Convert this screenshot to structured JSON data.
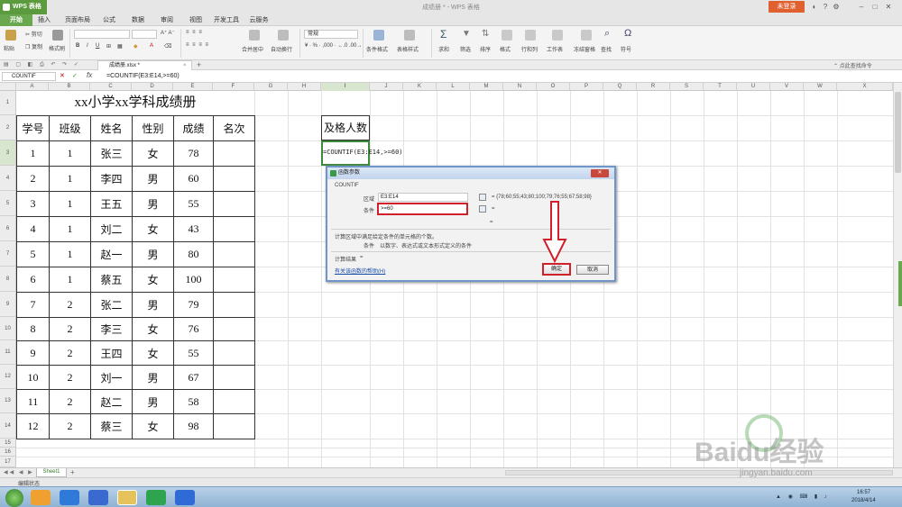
{
  "window": {
    "app_label": "WPS 表格",
    "title": "成绩册 * - WPS 表格",
    "login_label": "未登录"
  },
  "menu": [
    "开始",
    "插入",
    "页面布局",
    "公式",
    "数据",
    "审阅",
    "视图",
    "开发工具",
    "云服务"
  ],
  "ribbon": {
    "paste": "粘贴",
    "cut": "剪切",
    "copy": "复制",
    "format_painter": "格式刷",
    "merge_center": "合并居中",
    "wrap_text": "自动换行",
    "number_format": "常规",
    "conditional_format": "条件格式",
    "table_style": "表格样式",
    "sum": "求和",
    "filter": "筛选",
    "sort": "排序",
    "format": "格式",
    "rows_cols": "行和列",
    "worksheet": "工作表",
    "freeze": "冻结窗格",
    "find": "查找",
    "symbol": "符号"
  },
  "doc_tab": "成绩册.xlsx *",
  "collapse_label": "点此查找命令",
  "formula_bar": {
    "name_box": "COUNTIF",
    "formula": "=COUNTIF(E3:E14,>=60)"
  },
  "columns": [
    "A",
    "B",
    "C",
    "D",
    "E",
    "F",
    "G",
    "H",
    "I",
    "J",
    "K",
    "L",
    "M",
    "N",
    "O",
    "P",
    "Q",
    "R",
    "S",
    "T",
    "U",
    "V",
    "W",
    "X"
  ],
  "row_numbers": [
    "1",
    "2",
    "3",
    "4",
    "5",
    "6",
    "7",
    "8",
    "9",
    "10",
    "11",
    "12",
    "13",
    "14",
    "15",
    "16",
    "17"
  ],
  "sheet": {
    "title": "xx小学xx学科成绩册",
    "headers": [
      "学号",
      "班级",
      "姓名",
      "性别",
      "成绩",
      "名次"
    ],
    "rows": [
      [
        "1",
        "1",
        "张三",
        "女",
        "78",
        ""
      ],
      [
        "2",
        "1",
        "李四",
        "男",
        "60",
        ""
      ],
      [
        "3",
        "1",
        "王五",
        "男",
        "55",
        ""
      ],
      [
        "4",
        "1",
        "刘二",
        "女",
        "43",
        ""
      ],
      [
        "5",
        "1",
        "赵一",
        "男",
        "80",
        ""
      ],
      [
        "6",
        "1",
        "蔡五",
        "女",
        "100",
        ""
      ],
      [
        "7",
        "2",
        "张二",
        "男",
        "79",
        ""
      ],
      [
        "8",
        "2",
        "李三",
        "女",
        "76",
        ""
      ],
      [
        "9",
        "2",
        "王四",
        "女",
        "55",
        ""
      ],
      [
        "10",
        "2",
        "刘一",
        "男",
        "67",
        ""
      ],
      [
        "11",
        "2",
        "赵二",
        "男",
        "58",
        ""
      ],
      [
        "12",
        "2",
        "蔡三",
        "女",
        "98",
        ""
      ]
    ],
    "pass_label": "及格人数",
    "editing_formula": "=COUNTIF(E3:E14,>=60)"
  },
  "dialog": {
    "title": "函数参数",
    "func": "COUNTIF",
    "range_label": "区域",
    "range_value": "E3:E14",
    "range_result": "= {78;60;55;43;80;100;79;76;55;67;58;98}",
    "criteria_label": "条件",
    "criteria_value": ">=60",
    "criteria_result": "=",
    "eq": "=",
    "description": "计算区域中满足给定条件的单元格的个数。",
    "arg_help_label": "条件",
    "arg_help_text": "以数字、表达式或文本形式定义的条件",
    "result_label": "计算结果",
    "result_value": "=",
    "help_link": "有关该函数的帮助(H)",
    "ok": "确定",
    "cancel": "取消"
  },
  "sheet_tab": "Sheet1",
  "status": "编辑状态",
  "watermark": "Baidu经验",
  "watermark_url": "jingyan.baidu.com",
  "clock": {
    "time": "16:57",
    "date": "2018/4/14"
  },
  "colors": {
    "accent": "#6aa84f",
    "highlight": "#d0202a"
  }
}
